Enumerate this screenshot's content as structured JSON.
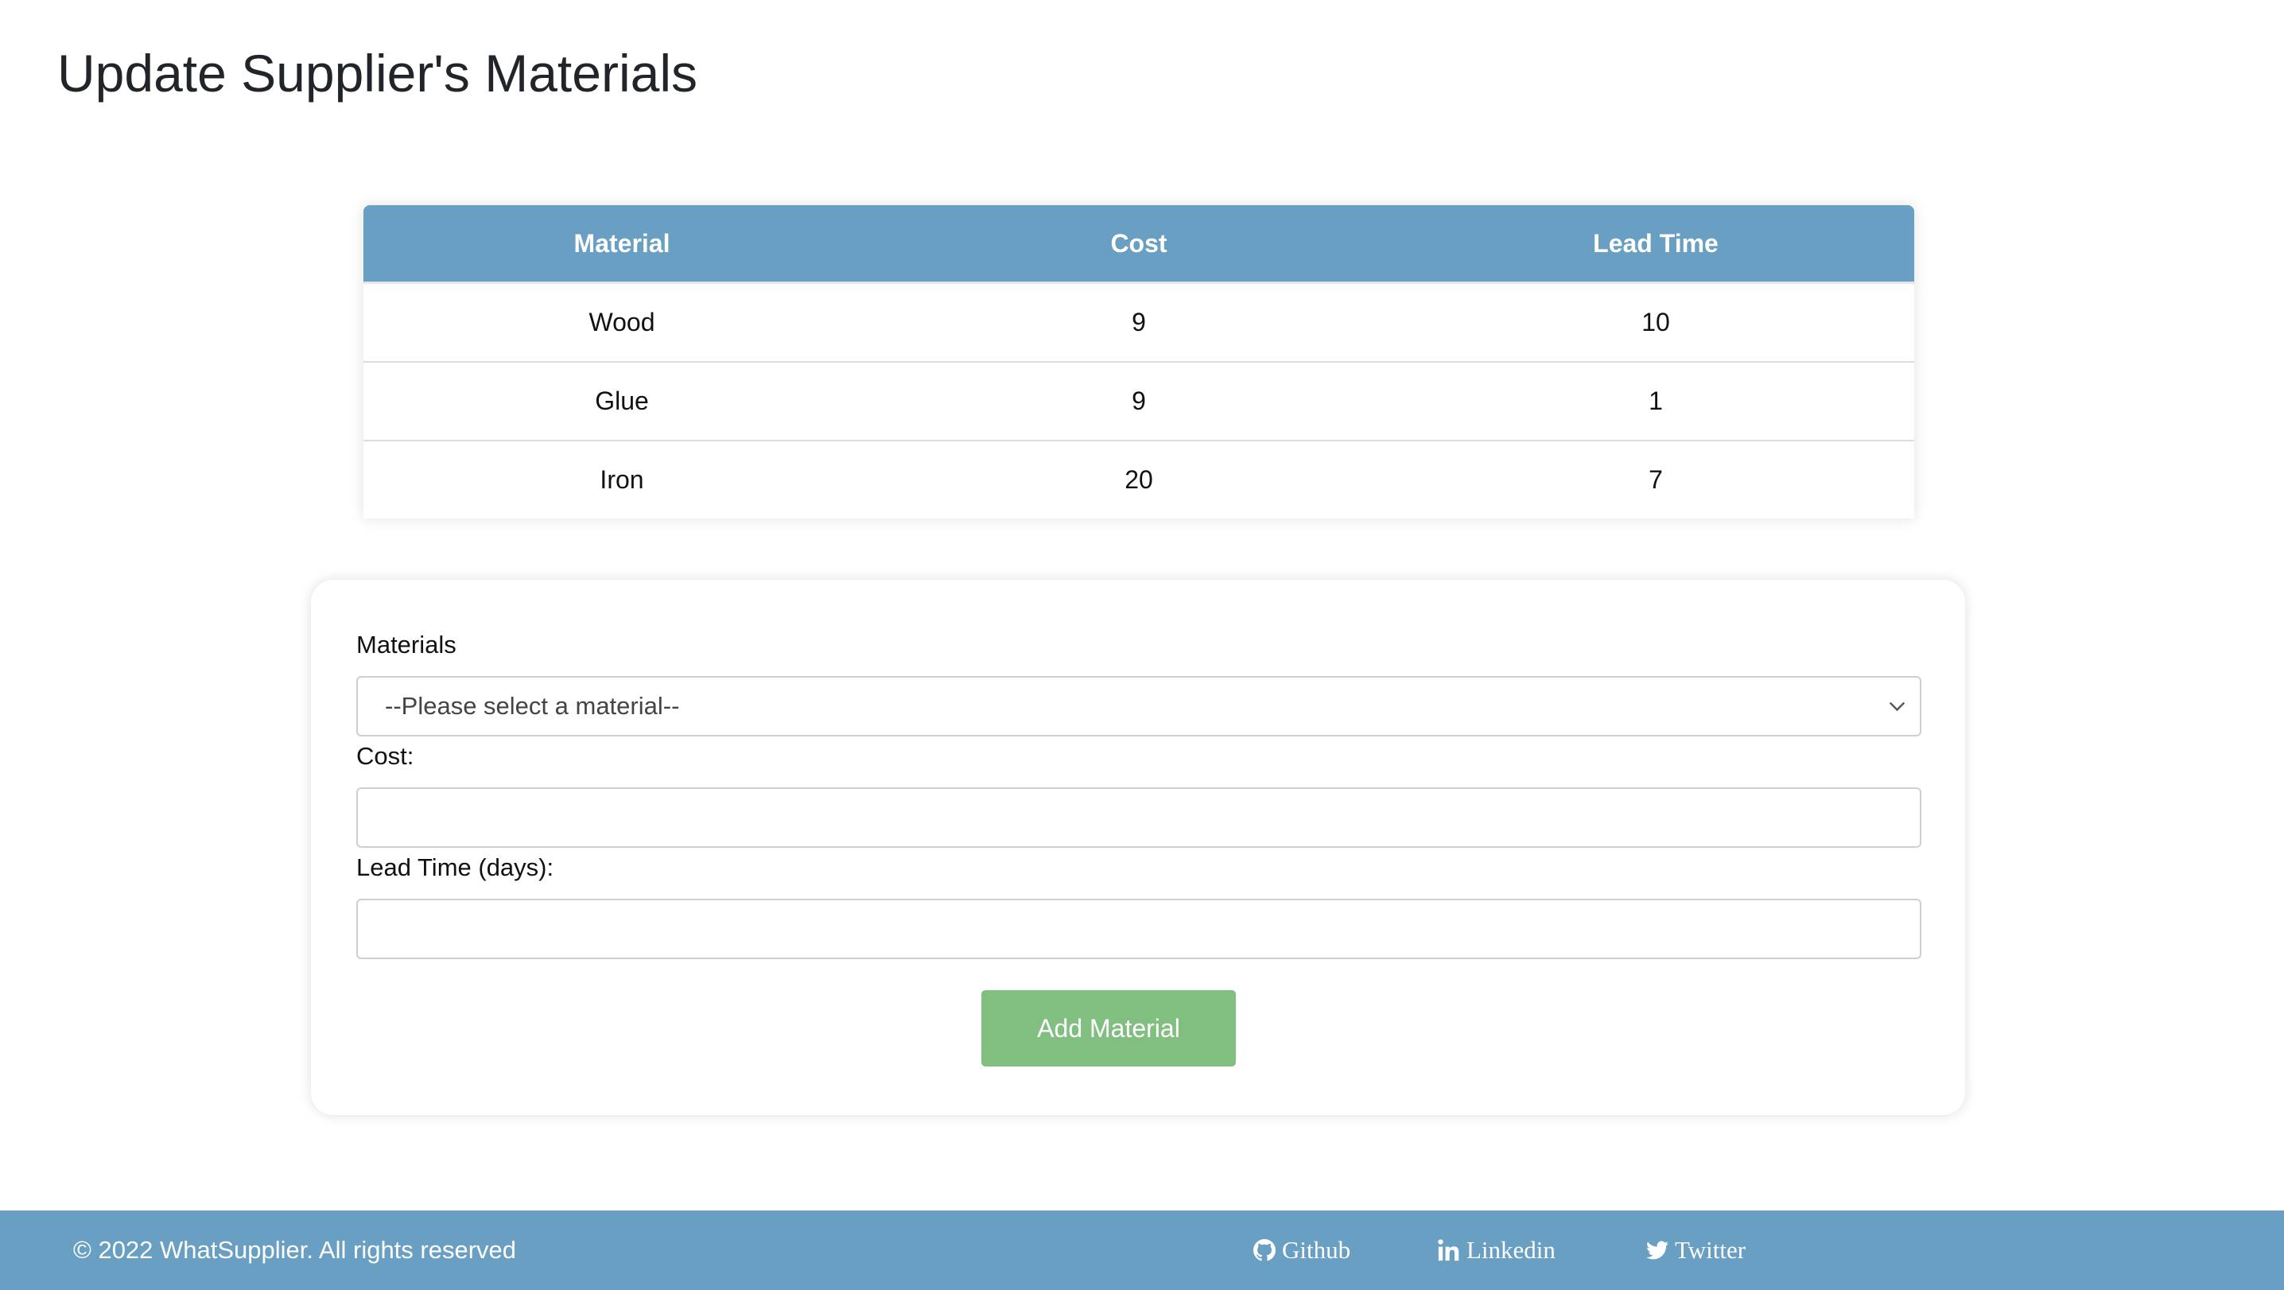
{
  "page": {
    "title": "Update Supplier's Materials"
  },
  "table": {
    "headers": [
      "Material",
      "Cost",
      "Lead Time"
    ],
    "rows": [
      {
        "material": "Wood",
        "cost": "9",
        "lead_time": "10"
      },
      {
        "material": "Glue",
        "cost": "9",
        "lead_time": "1"
      },
      {
        "material": "Iron",
        "cost": "20",
        "lead_time": "7"
      }
    ]
  },
  "form": {
    "materials_label": "Materials",
    "materials_selected": "--Please select a material--",
    "cost_label": "Cost:",
    "cost_value": "",
    "lead_time_label": "Lead Time (days):",
    "lead_time_value": "",
    "submit_label": "Add Material"
  },
  "footer": {
    "copyright": "© 2022 WhatSupplier. All rights reserved",
    "links": [
      {
        "label": "Github",
        "icon": "github-icon"
      },
      {
        "label": "Linkedin",
        "icon": "linkedin-icon"
      },
      {
        "label": "Twitter",
        "icon": "twitter-icon"
      }
    ]
  },
  "colors": {
    "header_bar": "#689fc2",
    "button": "#80bf80",
    "footer": "#689fc2"
  }
}
